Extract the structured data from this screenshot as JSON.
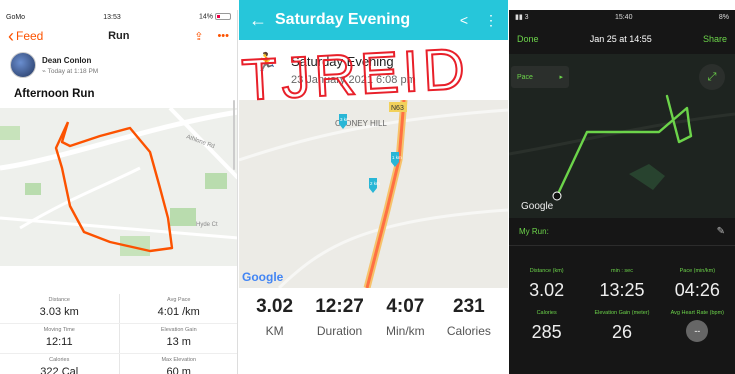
{
  "panel1": {
    "status": {
      "carrier": "GoMo",
      "time": "13:53",
      "battery": "14%"
    },
    "nav": {
      "back_label": "Feed",
      "title": "Run",
      "more": "•••"
    },
    "user": {
      "name": "Dean Conlon",
      "time": "Today at 1:18 PM"
    },
    "activity_title": "Afternoon Run",
    "map_labels": {
      "road1": "Athlone Rd",
      "road2": "Hyde Ct"
    },
    "stats": [
      [
        {
          "label": "Distance",
          "value": "3.03 km"
        },
        {
          "label": "Avg Pace",
          "value": "4:01 /km"
        }
      ],
      [
        {
          "label": "Moving Time",
          "value": "12:11"
        },
        {
          "label": "Elevation Gain",
          "value": "13 m"
        }
      ],
      [
        {
          "label": "Calories",
          "value": "322 Cal"
        },
        {
          "label": "Max Elevation",
          "value": "60 m"
        }
      ]
    ]
  },
  "panel2": {
    "header": {
      "title": "Saturday Evening"
    },
    "activity": {
      "title": "Saturday Evening",
      "date": "23 January 2021 6:08 pm"
    },
    "map_labels": {
      "place": "CLONEY HILL",
      "road": "N63",
      "google": "Google",
      "marker1": "1 km",
      "marker2": "2 km",
      "marker3": "3 km"
    },
    "handwriting": "TJREID",
    "stats": [
      {
        "value": "3.02",
        "label": "KM"
      },
      {
        "value": "12:27",
        "label": "Duration"
      },
      {
        "value": "4:07",
        "label": "Min/km"
      },
      {
        "value": "231",
        "label": "Calories"
      }
    ]
  },
  "panel3": {
    "status": {
      "signal": "3",
      "time": "15:40",
      "battery": "8%"
    },
    "nav": {
      "done": "Done",
      "date": "Jan 25 at 14:55",
      "share": "Share"
    },
    "map": {
      "pace_label": "Pace",
      "google": "Google"
    },
    "section_title": "My Run:",
    "stats": [
      [
        {
          "label": "Distance (km)",
          "value": "3.02"
        },
        {
          "label": "min : sec",
          "value": "13:25"
        },
        {
          "label": "Pace (min/km)",
          "value": "04:26"
        }
      ],
      [
        {
          "label": "Calories",
          "value": "285"
        },
        {
          "label": "Elevation Gain (meter)",
          "value": "26"
        },
        {
          "label": "Avg Heart Rate (bpm)",
          "value": "--"
        }
      ]
    ]
  },
  "colors": {
    "strava_orange": "#fc5200",
    "fit_teal": "#26c6da",
    "scrawl_red": "#e8202a",
    "tracker_green": "#6cd44a"
  }
}
